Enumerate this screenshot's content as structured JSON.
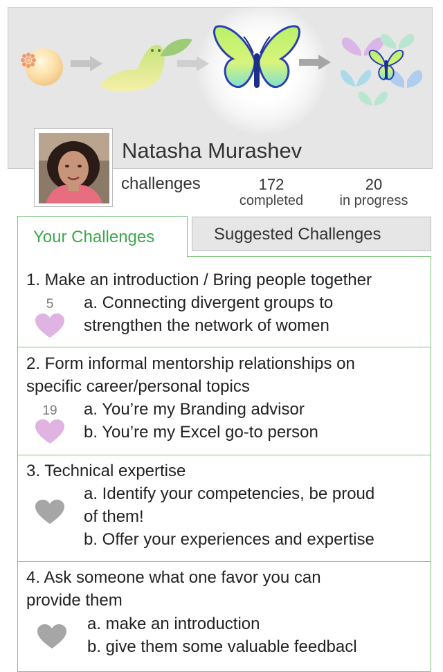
{
  "profile": {
    "name": "Natasha Murashev",
    "challenges_label": "challenges",
    "completed_count": "172",
    "completed_label": "completed",
    "in_progress_count": "20",
    "in_progress_label": "in progress"
  },
  "tabs": {
    "active": "Your Challenges",
    "inactive": "Suggested Challenges"
  },
  "challenges": [
    {
      "title": "1. Make an introduction / Bring people together",
      "likes": "5",
      "heart_color": "#dfb3e2",
      "items": [
        "a. Connecting divergent groups to",
        "strengthen the network of women"
      ]
    },
    {
      "title_line1": "2. Form informal mentorship relationships on",
      "title_line2": "specific career/personal topics",
      "likes": "19",
      "heart_color": "#dfb3e2",
      "items": [
        "a. You’re my Branding advisor",
        "b. You’re my Excel go-to person"
      ]
    },
    {
      "title": "3. Technical expertise",
      "heart_color": "#a6a6a6",
      "items": [
        "a. Identify your competencies, be proud",
        "of them!",
        "b. Offer your experiences and expertise"
      ]
    },
    {
      "title_line1": "4. Ask someone what one favor you can",
      "title_line2": "provide them",
      "heart_color": "#a6a6a6",
      "items": [
        "a. make an introduction",
        "b. give them some valuable feedbacl"
      ]
    }
  ]
}
